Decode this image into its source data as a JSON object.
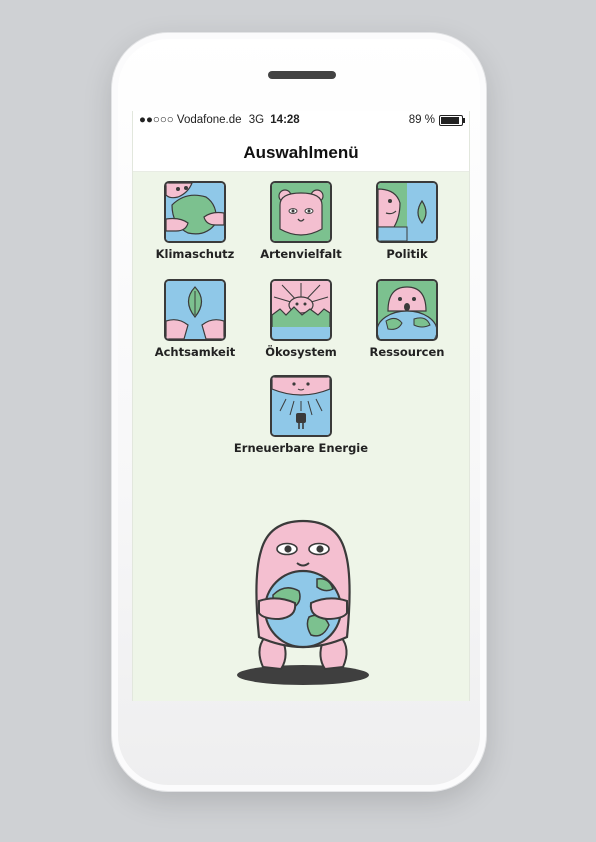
{
  "status_bar": {
    "carrier": "●●○○○ Vodafone.de",
    "network": "3G",
    "time": "14:28",
    "battery_percent": "89 %",
    "battery_level": 0.89
  },
  "header": {
    "title": "Auswahlmenü"
  },
  "menu": {
    "items": [
      {
        "label": "Klimaschutz",
        "icon": "hands-holding-earth-icon"
      },
      {
        "label": "Artenvielfalt",
        "icon": "bear-face-icon"
      },
      {
        "label": "Politik",
        "icon": "faces-leaf-icon"
      },
      {
        "label": "Achtsamkeit",
        "icon": "hands-leaf-icon"
      },
      {
        "label": "Ökosystem",
        "icon": "sun-landscape-icon"
      },
      {
        "label": "Ressourcen",
        "icon": "earth-face-icon"
      },
      {
        "label": "Erneuerbare Energie",
        "icon": "sun-plug-icon"
      }
    ]
  },
  "colors": {
    "pink": "#f4bfd0",
    "blue": "#8fc8e8",
    "green": "#7cc18f",
    "outline": "#3a3a3a",
    "screen_background": "#eef5e8"
  },
  "mascot": {
    "icon": "mascot-hugging-earth-illustration"
  }
}
